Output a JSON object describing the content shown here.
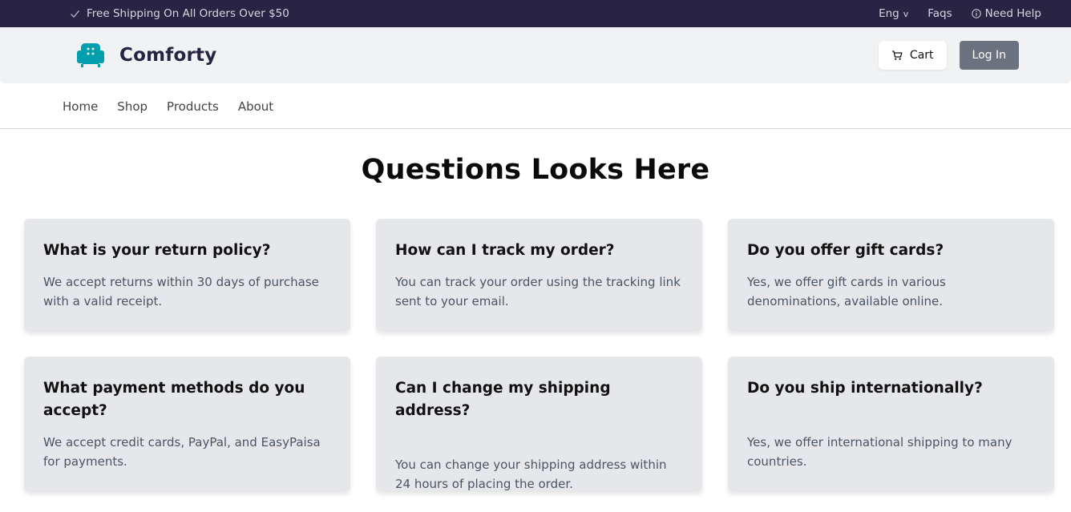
{
  "topbar": {
    "promo": "Free Shipping On All Orders Over $50",
    "lang": "Eng",
    "lang_caret": "v",
    "faqs": "Faqs",
    "help": "Need Help"
  },
  "header": {
    "brand": "Comforty",
    "cart": "Cart",
    "login": "Log In"
  },
  "nav": {
    "items": [
      "Home",
      "Shop",
      "Products",
      "About"
    ]
  },
  "faq": {
    "title": "Questions Looks Here",
    "items": [
      {
        "q": "What is your return policy?",
        "a": "We accept returns within 30 days of purchase with a valid receipt."
      },
      {
        "q": "How can I track my order?",
        "a": "You can track your order using the tracking link sent to your email."
      },
      {
        "q": "Do you offer gift cards?",
        "a": "Yes, we offer gift cards in various denominations, available online."
      },
      {
        "q": "What payment methods do you accept?",
        "a": "We accept credit cards, PayPal, and EasyPaisa for payments."
      },
      {
        "q": "Can I change my shipping address?",
        "a": "You can change your shipping address within 24 hours of placing the order."
      },
      {
        "q": "Do you ship internationally?",
        "a": "Yes, we offer international shipping to many countries."
      }
    ]
  },
  "colors": {
    "topbar": "#2a2444",
    "brand_accent": "#029fae",
    "login_button": "#6b7280",
    "card": "#e5e7eb"
  },
  "icons": [
    "check-icon",
    "info-icon",
    "armchair-logo-icon",
    "cart-icon"
  ]
}
